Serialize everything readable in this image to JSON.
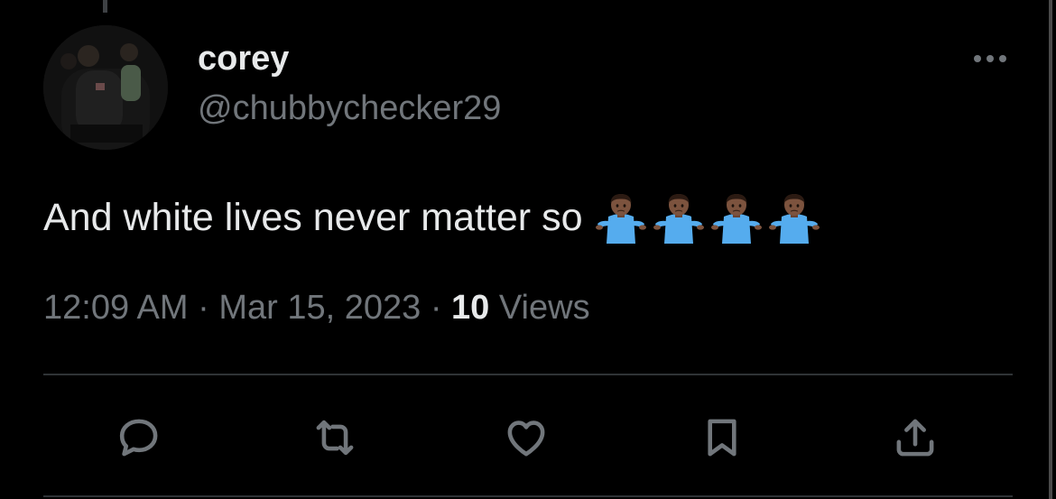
{
  "tweet": {
    "display_name": "corey",
    "handle": "@chubbychecker29",
    "text": "And white lives never matter so",
    "emoji_count": 4,
    "emoji_name": "person-shrugging-dark-skin-tone",
    "time": "12:09 AM",
    "separator": " · ",
    "date": "Mar 15, 2023",
    "views_count": "10",
    "views_label": " Views"
  },
  "actions": [
    {
      "icon": "reply-icon"
    },
    {
      "icon": "retweet-icon"
    },
    {
      "icon": "like-icon"
    },
    {
      "icon": "bookmark-icon"
    },
    {
      "icon": "share-icon"
    }
  ],
  "colors": {
    "background": "#000000",
    "primary_text": "#e7e9ea",
    "secondary_text": "#71767b",
    "divider": "#2f3336"
  }
}
